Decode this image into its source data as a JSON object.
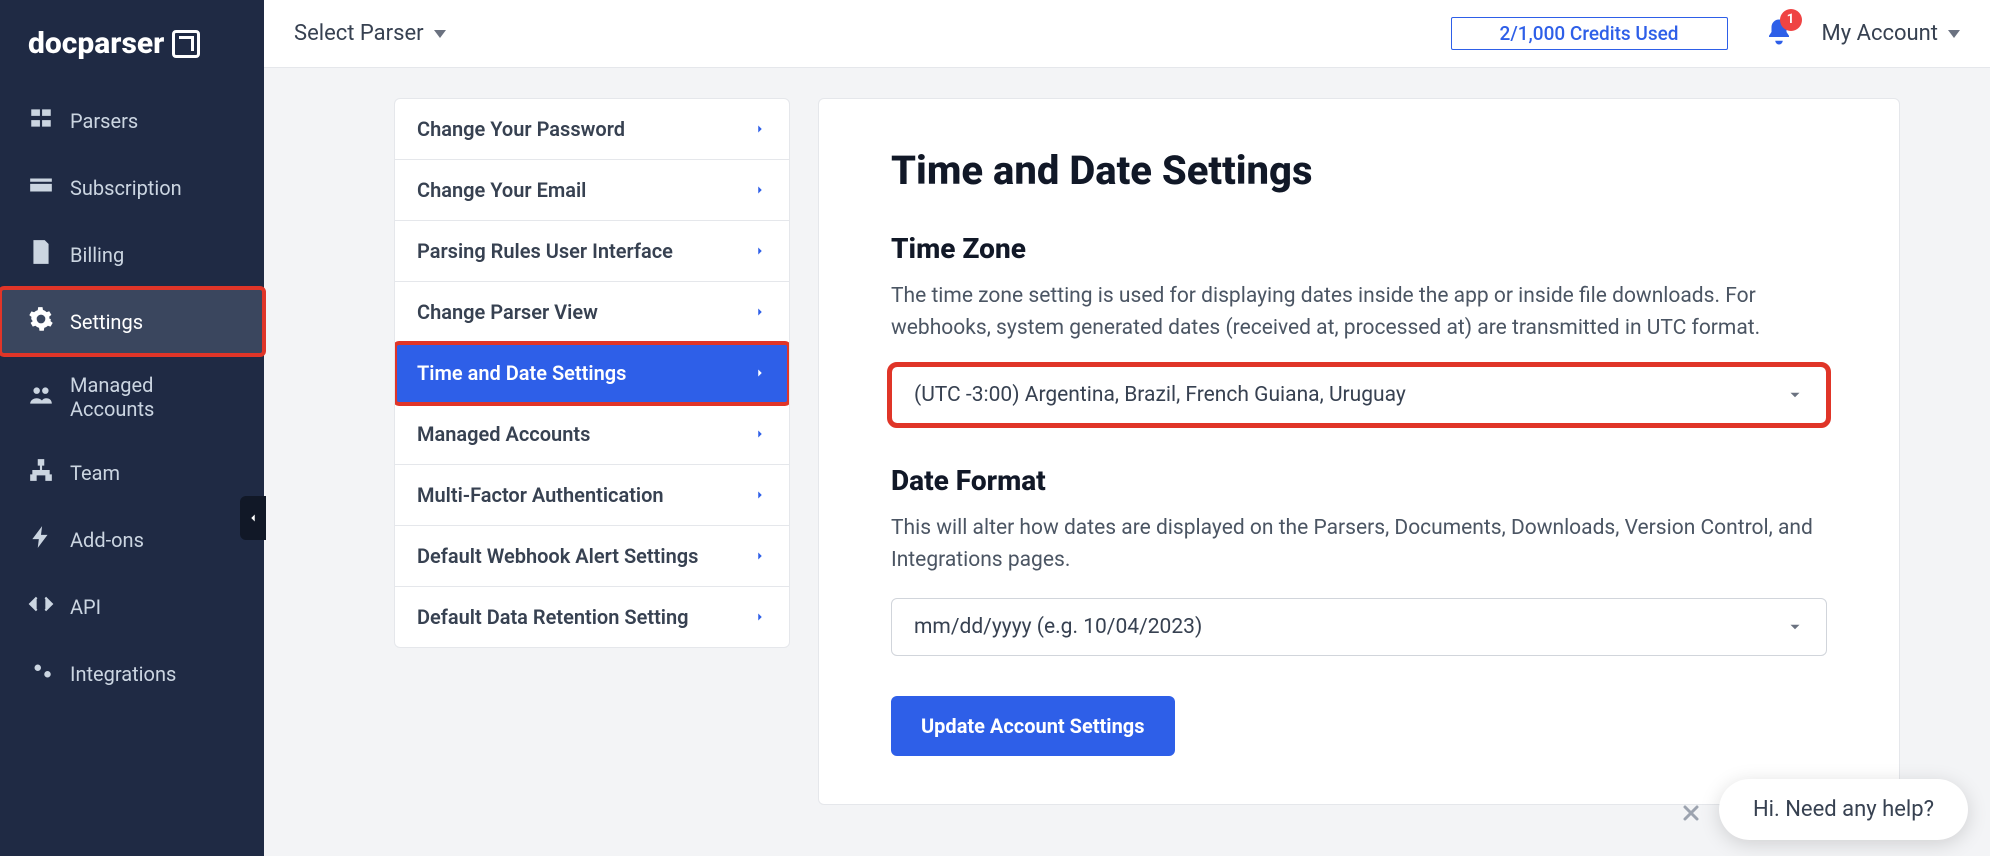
{
  "brand": "docparser",
  "topbar": {
    "select_parser": "Select Parser",
    "credits": "2/1,000 Credits Used",
    "notif_count": "1",
    "account": "My Account"
  },
  "sidebar": {
    "items": [
      {
        "label": "Parsers",
        "icon": "parsers-icon"
      },
      {
        "label": "Subscription",
        "icon": "card-icon"
      },
      {
        "label": "Billing",
        "icon": "file-icon"
      },
      {
        "label": "Settings",
        "icon": "gear-icon",
        "active": true
      },
      {
        "label": "Managed Accounts",
        "icon": "users-icon"
      },
      {
        "label": "Team",
        "icon": "hierarchy-icon"
      },
      {
        "label": "Add-ons",
        "icon": "bolt-icon"
      },
      {
        "label": "API",
        "icon": "code-icon"
      },
      {
        "label": "Integrations",
        "icon": "gears-icon"
      }
    ]
  },
  "submenu": {
    "items": [
      "Change Your Password",
      "Change Your Email",
      "Parsing Rules User Interface",
      "Change Parser View",
      "Time and Date Settings",
      "Managed Accounts",
      "Multi-Factor Authentication",
      "Default Webhook Alert Settings",
      "Default Data Retention Setting"
    ],
    "active_index": 4
  },
  "panel": {
    "title": "Time and Date Settings",
    "tz_heading": "Time Zone",
    "tz_desc": "The time zone setting is used for displaying dates inside the app or inside file downloads. For webhooks, system generated dates (received at, processed at) are transmitted in UTC format.",
    "tz_value": "(UTC -3:00) Argentina, Brazil, French Guiana, Uruguay",
    "df_heading": "Date Format",
    "df_desc": "This will alter how dates are displayed on the Parsers, Documents, Downloads, Version Control, and Integrations pages.",
    "df_value": "mm/dd/yyyy (e.g. 10/04/2023)",
    "update_btn": "Update Account Settings"
  },
  "help": {
    "text": "Hi. Need any help?"
  },
  "highlight": {
    "sidebar_index": 3,
    "submenu_index": 4,
    "timezone_select": true
  }
}
